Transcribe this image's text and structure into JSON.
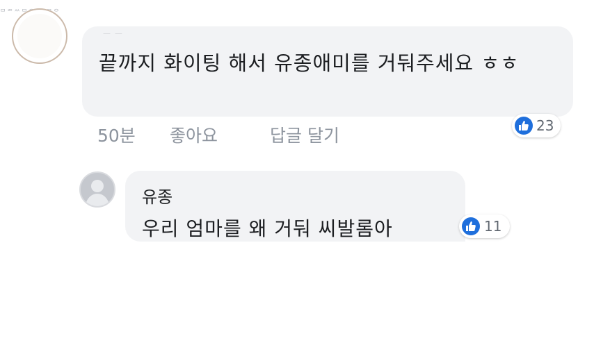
{
  "top_faded_text": "ᄆᄅᄌᄊᄆᄋ  ᄀᄅᄀᄋ",
  "comment_1": {
    "author_name": "ᅳ ᅳ",
    "text": "끝까지 화이팅 해서 유종애미를 거둬주세요 ㅎㅎ",
    "reaction_icon": "like-icon",
    "reaction_count": "23",
    "time": "50분",
    "like_action": "좋아요",
    "reply_action": "답글 달기"
  },
  "comment_2": {
    "author_name": "유종",
    "text": "우리 엄마를 왜 거둬 씨발롬아",
    "reaction_icon": "like-icon",
    "reaction_count": "11"
  },
  "colors": {
    "bubble_bg": "#f2f3f5",
    "like_blue": "#1f6fdc",
    "meta_gray": "#8d949e",
    "text_dark": "#1c1e21"
  }
}
